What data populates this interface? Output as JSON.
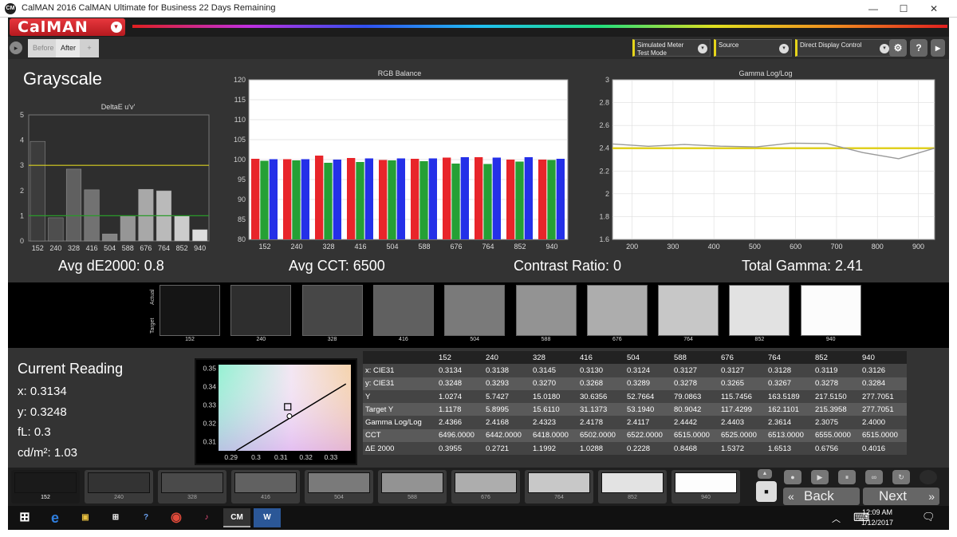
{
  "window": {
    "title": "CalMAN 2016 CalMAN Ultimate for Business 22 Days Remaining",
    "logo_text": "CM",
    "minimize": "—",
    "maximize": "☐",
    "close": "✕"
  },
  "header": {
    "app_name": "CalMAN",
    "menu_caret": "▾"
  },
  "toolbar": {
    "nav_arrow": "▸",
    "tab_before": "Before",
    "tab_after": "After",
    "tab_add": "+",
    "meter": {
      "line1": "Simulated Meter",
      "line2": "Test Mode"
    },
    "source": {
      "line1": "Source"
    },
    "display": {
      "line1": "Direct Display Control"
    },
    "dropdown_arrow": "▾",
    "settings_icon": "⚙",
    "help_icon": "?",
    "expand_icon": "▸"
  },
  "page": {
    "title": "Grayscale"
  },
  "stats": {
    "avg_de": "Avg dE2000: 0.8",
    "avg_cct": "Avg CCT: 6500",
    "contrast": "Contrast Ratio: 0",
    "gamma": "Total Gamma: 2.41"
  },
  "chart_data": [
    {
      "type": "bar",
      "title": "DeltaE u'v'",
      "categories": [
        "152",
        "240",
        "328",
        "416",
        "504",
        "588",
        "676",
        "764",
        "852",
        "940"
      ],
      "values": [
        3.95,
        0.92,
        2.85,
        2.03,
        0.28,
        0.98,
        2.05,
        1.99,
        1.0,
        0.45
      ],
      "ylim": [
        0,
        5
      ],
      "yticks": [
        "0",
        "1",
        "2",
        "3",
        "4",
        "5"
      ],
      "reference_lines": [
        {
          "value": 3,
          "color": "#d8d020"
        },
        {
          "value": 1,
          "color": "#2a9a2a"
        }
      ]
    },
    {
      "type": "bar",
      "title": "RGB Balance",
      "categories": [
        "152",
        "240",
        "328",
        "416",
        "504",
        "588",
        "676",
        "764",
        "852",
        "940"
      ],
      "series": [
        {
          "color": "#e8252a",
          "values": [
            100.2,
            100.1,
            101.0,
            100.4,
            99.9,
            100.2,
            100.5,
            100.6,
            100.0,
            100.0
          ]
        },
        {
          "color": "#25a035",
          "values": [
            99.7,
            99.8,
            99.2,
            99.4,
            99.8,
            99.6,
            99.0,
            98.9,
            99.5,
            99.9
          ]
        },
        {
          "color": "#2430e8",
          "values": [
            100.1,
            100.1,
            100.0,
            100.3,
            100.3,
            100.3,
            100.6,
            100.5,
            100.6,
            100.2
          ]
        }
      ],
      "ylim": [
        80,
        120
      ],
      "yticks": [
        "80",
        "85",
        "90",
        "95",
        "100",
        "105",
        "110",
        "115",
        "120"
      ]
    },
    {
      "type": "line",
      "title": "Gamma Log/Log",
      "x": [
        152,
        240,
        328,
        416,
        504,
        588,
        676,
        764,
        852,
        940
      ],
      "series": [
        {
          "color": "#999999",
          "values": [
            2.4366,
            2.4168,
            2.4323,
            2.4178,
            2.4117,
            2.4442,
            2.4403,
            2.3614,
            2.3075,
            2.4
          ]
        }
      ],
      "target_line": {
        "value": 2.4,
        "color": "#e0d020"
      },
      "xlim": [
        152,
        940
      ],
      "ylim": [
        1.6,
        3.0
      ],
      "xticks": [
        200,
        300,
        400,
        500,
        600,
        700,
        800,
        900
      ],
      "xtick_labels": [
        "200",
        "300",
        "400",
        "500",
        "600",
        "700",
        "800",
        "900"
      ],
      "yticks": [
        1.6,
        1.8,
        2.0,
        2.2,
        2.4,
        2.6,
        2.8,
        3.0
      ],
      "ytick_labels": [
        "1.6",
        "1.8",
        "2",
        "2.2",
        "2.4",
        "2.6",
        "2.8",
        "3"
      ]
    }
  ],
  "swatches": {
    "actual_label": "Actual",
    "target_label": "Target",
    "items": [
      {
        "label": "152",
        "color": "#151515"
      },
      {
        "label": "240",
        "color": "#2e2e2e"
      },
      {
        "label": "328",
        "color": "#474747"
      },
      {
        "label": "416",
        "color": "#606060"
      },
      {
        "label": "504",
        "color": "#7a7a7a"
      },
      {
        "label": "588",
        "color": "#939393"
      },
      {
        "label": "676",
        "color": "#adadad"
      },
      {
        "label": "764",
        "color": "#c7c7c7"
      },
      {
        "label": "852",
        "color": "#e2e2e2"
      },
      {
        "label": "940",
        "color": "#fcfcfc"
      }
    ]
  },
  "reading": {
    "title": "Current Reading",
    "x": "x: 0.3134",
    "y": "y: 0.3248",
    "fl": "fL: 0.3",
    "cdm2": "cd/m²: 1.03"
  },
  "cie": {
    "xticks": [
      "0.29",
      "0.3",
      "0.31",
      "0.32",
      "0.33"
    ],
    "yticks": [
      "0.35",
      "0.34",
      "0.33",
      "0.32",
      "0.31"
    ]
  },
  "table": {
    "columns": [
      "152",
      "240",
      "328",
      "416",
      "504",
      "588",
      "676",
      "764",
      "852",
      "940"
    ],
    "rows": [
      {
        "label": "x: CIE31",
        "values": [
          "0.3134",
          "0.3138",
          "0.3145",
          "0.3130",
          "0.3124",
          "0.3127",
          "0.3127",
          "0.3128",
          "0.3119",
          "0.3126"
        ]
      },
      {
        "label": "y: CIE31",
        "values": [
          "0.3248",
          "0.3293",
          "0.3270",
          "0.3268",
          "0.3289",
          "0.3278",
          "0.3265",
          "0.3267",
          "0.3278",
          "0.3284"
        ]
      },
      {
        "label": "Y",
        "values": [
          "1.0274",
          "5.7427",
          "15.0180",
          "30.6356",
          "52.7664",
          "79.0863",
          "115.7456",
          "163.5189",
          "217.5150",
          "277.7051"
        ]
      },
      {
        "label": "Target Y",
        "values": [
          "1.1178",
          "5.8995",
          "15.6110",
          "31.1373",
          "53.1940",
          "80.9042",
          "117.4299",
          "162.1101",
          "215.3958",
          "277.7051"
        ]
      },
      {
        "label": "Gamma Log/Log",
        "values": [
          "2.4366",
          "2.4168",
          "2.4323",
          "2.4178",
          "2.4117",
          "2.4442",
          "2.4403",
          "2.3614",
          "2.3075",
          "2.4000"
        ]
      },
      {
        "label": "CCT",
        "values": [
          "6496.0000",
          "6442.0000",
          "6418.0000",
          "6502.0000",
          "6522.0000",
          "6515.0000",
          "6525.0000",
          "6513.0000",
          "6555.0000",
          "6515.0000"
        ]
      },
      {
        "label": "ΔE 2000",
        "values": [
          "0.3955",
          "0.2721",
          "1.1992",
          "1.0288",
          "0.2228",
          "0.8468",
          "1.5372",
          "1.6513",
          "0.6756",
          "0.4016"
        ]
      }
    ]
  },
  "patches": [
    {
      "label": "152",
      "color": "#1a1a1a"
    },
    {
      "label": "240",
      "color": "#333333"
    },
    {
      "label": "328",
      "color": "#4a4a4a"
    },
    {
      "label": "416",
      "color": "#616161"
    },
    {
      "label": "504",
      "color": "#7a7a7a"
    },
    {
      "label": "588",
      "color": "#939393"
    },
    {
      "label": "676",
      "color": "#adadad"
    },
    {
      "label": "764",
      "color": "#c8c8c8"
    },
    {
      "label": "852",
      "color": "#e3e3e3"
    },
    {
      "label": "940",
      "color": "#fdfdfd"
    }
  ],
  "controls": {
    "back": "Back",
    "next": "Next",
    "back_icon": "«",
    "next_icon": "»",
    "up_icon": "▲",
    "stop_icon": "■",
    "record_icon": "●",
    "play_icon": "▶",
    "pause_icon": "⏸",
    "loop_icon": "∞",
    "refresh_icon": "↻"
  },
  "taskbar": {
    "start_icon": "⊞",
    "apps": [
      "e",
      "▣",
      "⊞",
      "?",
      "◉",
      "♪",
      "CM",
      "W"
    ],
    "time": "12:09 AM",
    "date": "1/12/2017",
    "up_icon": "︿",
    "keyboard_icon": "⌨",
    "notify_icon": "🗨"
  }
}
